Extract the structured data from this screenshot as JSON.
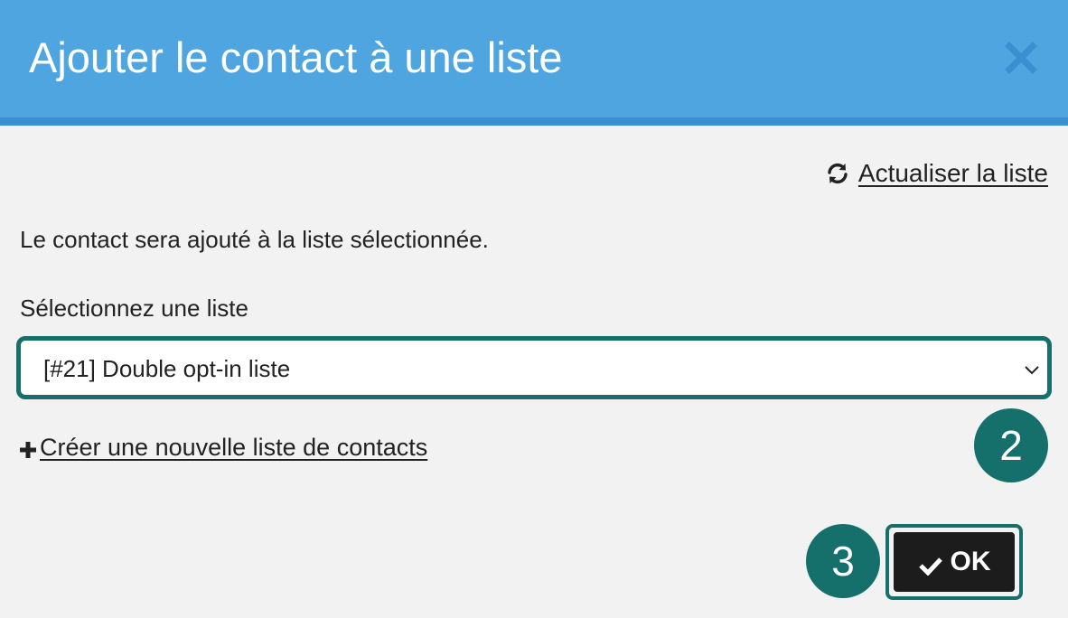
{
  "dialog": {
    "title": "Ajouter le contact à une liste",
    "close_icon": "close-icon",
    "header_color": "#4ea5e0",
    "accent_color": "#156f6a"
  },
  "refresh": {
    "icon": "refresh-icon",
    "label": "Actualiser la liste"
  },
  "help_text": "Le contact sera ajouté à la liste sélectionnée.",
  "list_select": {
    "label": "Sélectionnez une liste",
    "selected": "[#21] Double opt-in liste"
  },
  "create_list": {
    "icon": "plus-icon",
    "label": "Créer une nouvelle liste de contacts"
  },
  "steps": {
    "select_step": "2",
    "ok_step": "3"
  },
  "ok_button": {
    "icon": "check-icon",
    "label": "OK"
  }
}
